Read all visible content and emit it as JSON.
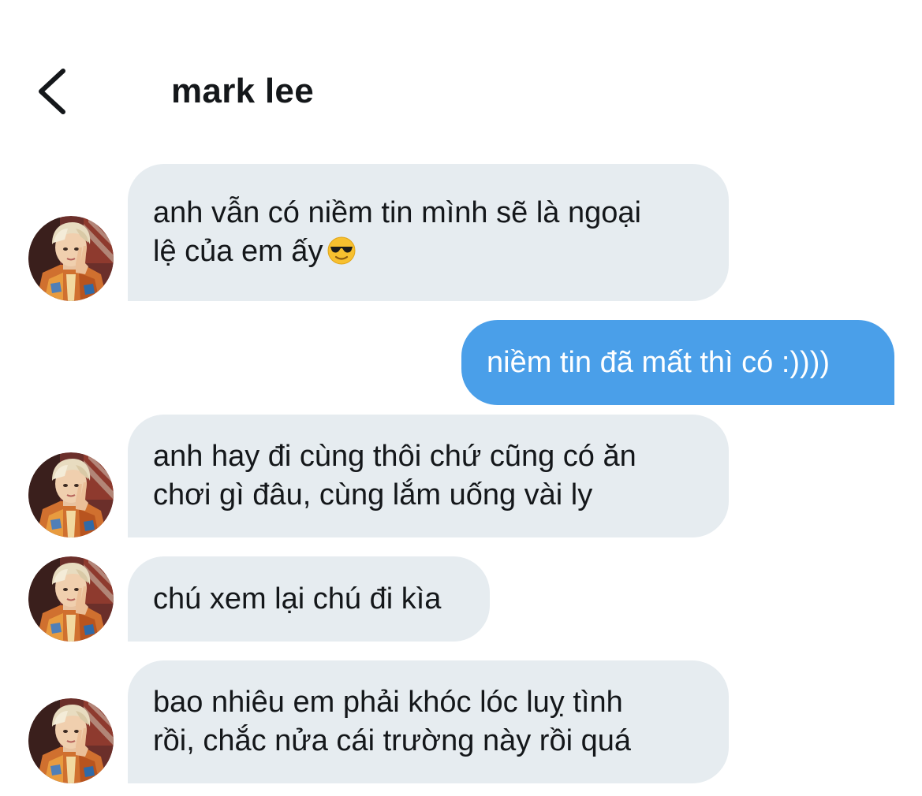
{
  "header": {
    "title": "mark lee",
    "back_icon": "chevron-left-icon"
  },
  "colors": {
    "incoming_bubble": "#e6ecf0",
    "outgoing_bubble": "#4a9fe9",
    "text": "#14171a"
  },
  "messages": [
    {
      "from": "them",
      "lines": [
        "anh vẫn có niềm tin mình sẽ là ngoại",
        "lệ của em ấy"
      ],
      "trailing_icon": "sunglasses-emoji-icon"
    },
    {
      "from": "me",
      "lines": [
        "niềm tin đã mất thì có :))))"
      ]
    },
    {
      "from": "them",
      "lines": [
        "anh hay đi cùng thôi chứ cũng có ăn",
        "chơi gì đâu, cùng lắm uống vài ly"
      ]
    },
    {
      "from": "them",
      "lines": [
        "chú xem lại chú đi kìa"
      ]
    },
    {
      "from": "them",
      "lines": [
        "bao nhiêu em phải khóc lóc luỵ tình",
        "rồi, chắc nửa cái trường này rồi quá"
      ]
    }
  ]
}
